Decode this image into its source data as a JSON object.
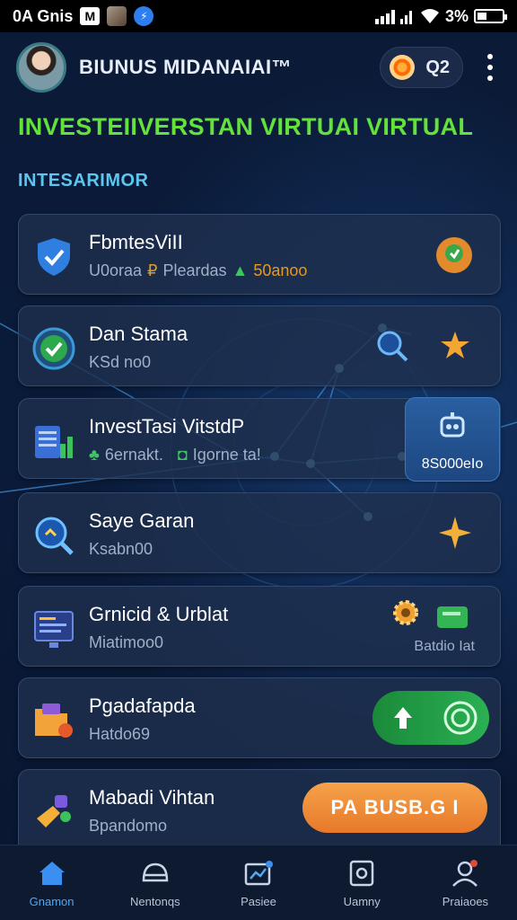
{
  "status_bar": {
    "left_text": "0A Gnis",
    "app_badge": "M",
    "battery_text": "3%"
  },
  "header": {
    "title": "BIUNUS MIDANAIAI™",
    "points_value": "Q2"
  },
  "headline": "INVESTEIIVERSTAN VIRTUAI VIRTUAL",
  "section_title": "INTESARIMOR",
  "cards": [
    {
      "name": "FbmtesViII",
      "sub_1": "U0oraa",
      "sub_2": "Pleardas",
      "sub_3": "50anoo"
    },
    {
      "name": "Dan Stama",
      "sub": "KSd no0"
    },
    {
      "name": "InvestTasi VitstdP",
      "sub_1": "6ernakt.",
      "sub_2": "Igorne ta!",
      "badge_text": "8S000eIo"
    },
    {
      "name": "Saye Garan",
      "sub": "Ksabn00"
    },
    {
      "name": "Grnicid & Urblat",
      "sub": "Miatimoo0",
      "right_label": "Batdio Iat"
    },
    {
      "name": "Pgadafapda",
      "sub": "Hatdo69"
    },
    {
      "name": "Mabadi Vihtan",
      "sub": "Bpandomo",
      "cta": "PA BUSB.G I"
    }
  ],
  "bottom_nav": [
    {
      "label": "Gnamon",
      "active": true
    },
    {
      "label": "Nentonqs",
      "active": false
    },
    {
      "label": "Pasiee",
      "active": false
    },
    {
      "label": "Uamny",
      "active": false
    },
    {
      "label": "Praiaoes",
      "active": false
    }
  ],
  "colors": {
    "headline": "#62e23a",
    "section": "#5cc6ee",
    "accent_blue": "#4fa8f0",
    "cta_orange": "#f09a3a",
    "toggle_green": "#2bb052"
  }
}
